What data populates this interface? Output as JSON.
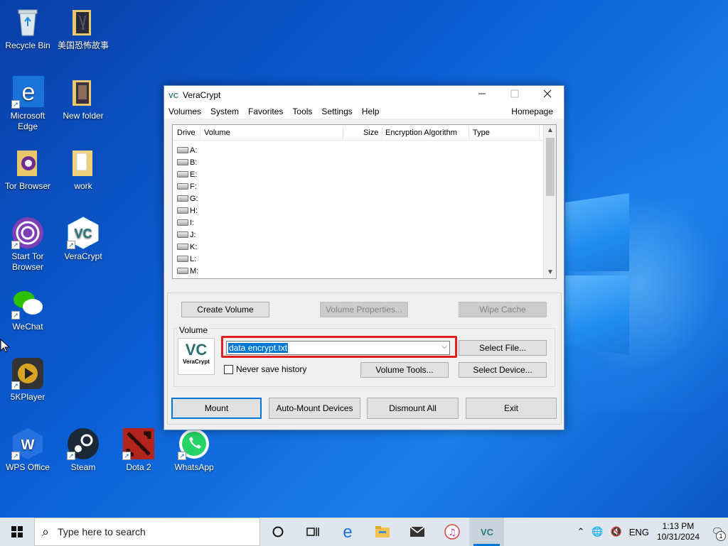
{
  "desktop": {
    "icons": [
      {
        "label": "Recycle Bin",
        "icon": "recycle-bin-icon"
      },
      {
        "label": "美国恐怖故事",
        "icon": "folder-icon"
      },
      {
        "label": "Microsoft Edge",
        "icon": "edge-icon"
      },
      {
        "label": "New folder",
        "icon": "folder-icon"
      },
      {
        "label": "Tor Browser",
        "icon": "folder-icon"
      },
      {
        "label": "work",
        "icon": "folder-icon"
      },
      {
        "label": "Start Tor Browser",
        "icon": "tor-icon"
      },
      {
        "label": "VeraCrypt",
        "icon": "veracrypt-icon"
      },
      {
        "label": "WeChat",
        "icon": "wechat-icon"
      },
      {
        "label": "5KPlayer",
        "icon": "5kplayer-icon"
      },
      {
        "label": "WPS Office",
        "icon": "wps-icon"
      },
      {
        "label": "Steam",
        "icon": "steam-icon"
      },
      {
        "label": "Dota 2",
        "icon": "dota-icon"
      },
      {
        "label": "WhatsApp",
        "icon": "whatsapp-icon"
      }
    ]
  },
  "window": {
    "title": "VeraCrypt",
    "menu": [
      "Volumes",
      "System",
      "Favorites",
      "Tools",
      "Settings",
      "Help"
    ],
    "homepage": "Homepage",
    "columns": {
      "drive": "Drive",
      "volume": "Volume",
      "size": "Size",
      "algorithm": "Encryption Algorithm",
      "type": "Type"
    },
    "drives": [
      "A:",
      "B:",
      "E:",
      "F:",
      "G:",
      "H:",
      "I:",
      "J:",
      "K:",
      "L:",
      "M:"
    ],
    "buttons": {
      "create_volume": "Create Volume",
      "volume_properties": "Volume Properties...",
      "wipe_cache": "Wipe Cache",
      "select_file": "Select File...",
      "volume_tools": "Volume Tools...",
      "select_device": "Select Device...",
      "mount": "Mount",
      "auto_mount": "Auto-Mount Devices",
      "dismount_all": "Dismount All",
      "exit": "Exit"
    },
    "volume_group_label": "Volume",
    "volume_path": "data encrypt.txt",
    "never_save_history": "Never save history",
    "logo_text": "VeraCrypt"
  },
  "taskbar": {
    "search_placeholder": "Type here to search",
    "language": "ENG",
    "time": "1:13 PM",
    "date": "10/31/2024",
    "notification_count": "1"
  },
  "colors": {
    "accent": "#0078d7",
    "highlight_box": "#e02020"
  }
}
